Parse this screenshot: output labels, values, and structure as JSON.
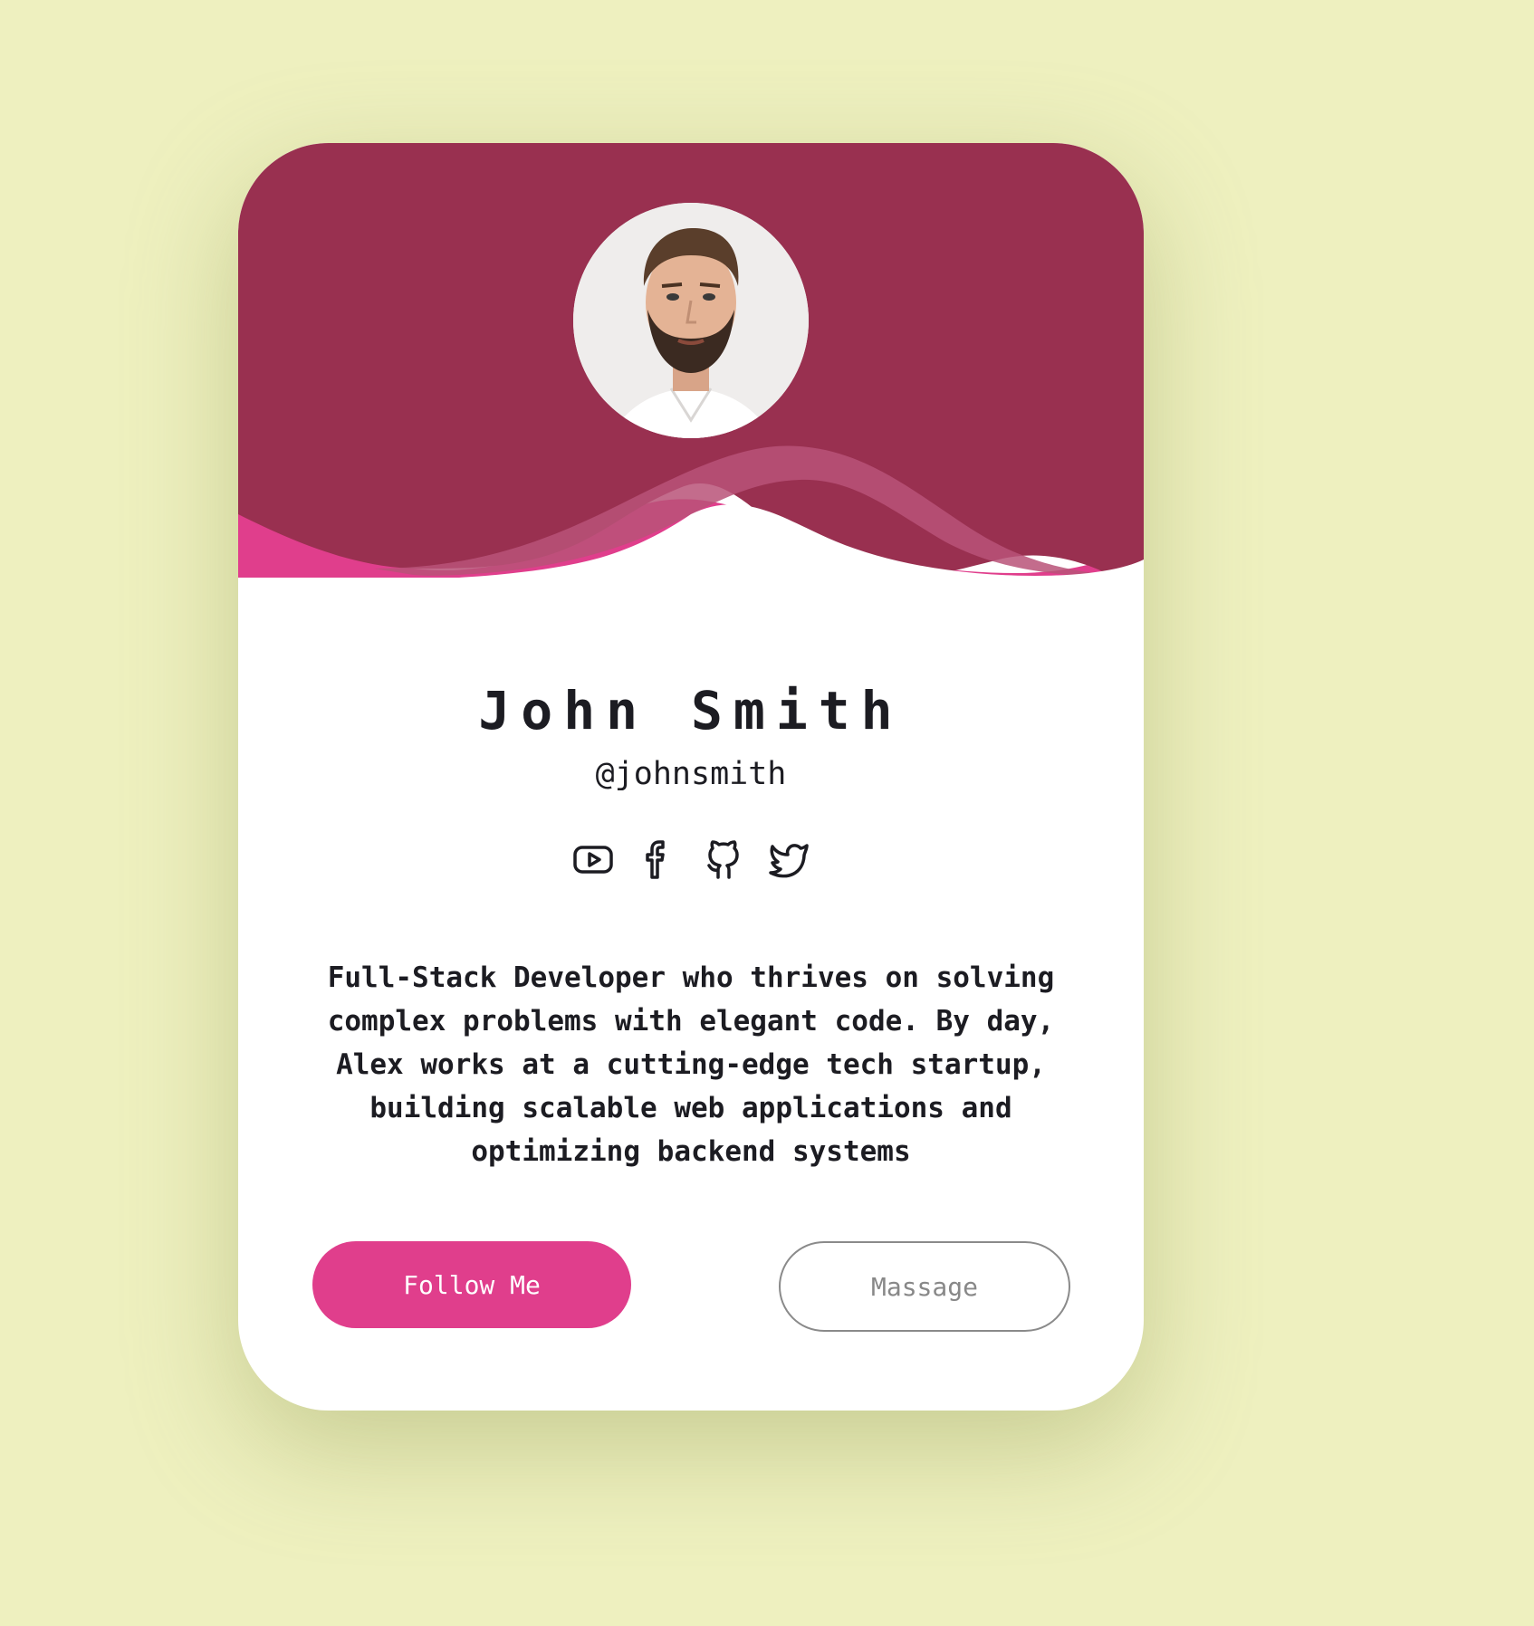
{
  "colors": {
    "page_background": "#eef0bf",
    "header": "#993050",
    "wave_pink": "#e03e8c",
    "wave_light": "#b85278",
    "follow_button": "#e03e8c",
    "text": "#1c1c22"
  },
  "profile": {
    "avatar_alt": "profile-photo",
    "name": "John Smith",
    "handle": "@johnsmith",
    "bio": "Full-Stack Developer who thrives on solving complex problems with elegant code. By day, Alex works at a cutting-edge tech startup, building scalable web applications and optimizing backend systems"
  },
  "socials": [
    {
      "icon": "youtube-icon"
    },
    {
      "icon": "facebook-icon"
    },
    {
      "icon": "github-icon"
    },
    {
      "icon": "twitter-icon"
    }
  ],
  "actions": {
    "follow_label": "Follow Me",
    "message_label": "Massage"
  }
}
